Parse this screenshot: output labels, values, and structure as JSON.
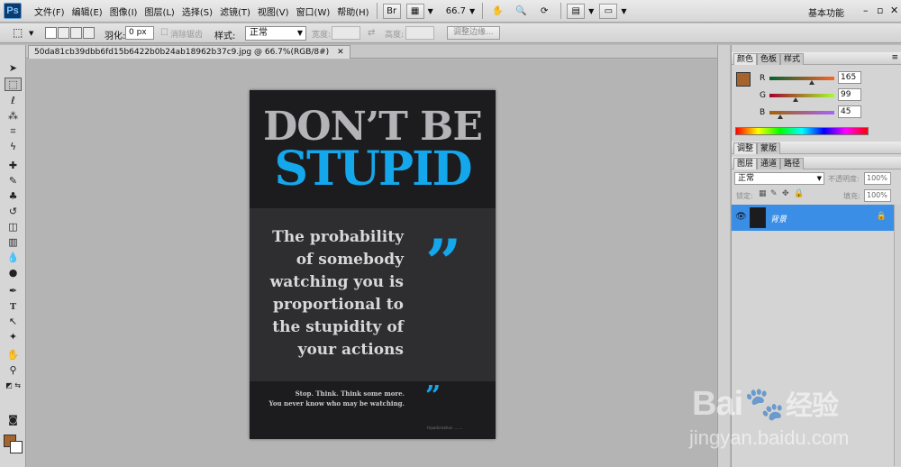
{
  "app": {
    "logo": "Ps"
  },
  "menu": [
    "文件(F)",
    "编辑(E)",
    "图像(I)",
    "图层(L)",
    "选择(S)",
    "滤镜(T)",
    "视图(V)",
    "窗口(W)",
    "帮助(H)"
  ],
  "toolbar": {
    "zoom": "66.7",
    "workspace": "基本功能"
  },
  "options": {
    "feather_label": "羽化:",
    "feather_value": "0 px",
    "antialias_label": "消除锯齿",
    "style_label": "样式:",
    "style_value": "正常",
    "width_label": "宽度:",
    "height_label": "高度:",
    "refine_edge": "调整边缘..."
  },
  "document": {
    "tab_title": "50da81cb39dbb6fd15b6422b0b24ab18962b37c9.jpg @ 66.7%(RGB/8#)",
    "close": "✕"
  },
  "poster": {
    "headline_line1": "DON’T BE",
    "headline_line2": "STUPID",
    "quote_lines": [
      "The probability",
      "of somebody",
      "watching you is",
      "proportional to",
      "the stupidity of",
      "your actions"
    ],
    "quote_mark": "”",
    "footer_line1": "Stop. Think. Think some more.",
    "footer_line2": "You never know who may be watching.",
    "credit": "tripadcreative ........",
    "accent_color": "#14a7ec"
  },
  "color_panel": {
    "tabs": [
      "颜色",
      "色板",
      "样式"
    ],
    "r_label": "R",
    "r_value": "165",
    "g_label": "G",
    "g_value": "99",
    "b_label": "B",
    "b_value": "45",
    "foreground_color": "#a5632d"
  },
  "adjust_panel": {
    "tabs": [
      "调整",
      "蒙版"
    ]
  },
  "layers_panel": {
    "tabs": [
      "图层",
      "通道",
      "路径"
    ],
    "blend_mode": "正常",
    "opacity_label": "不透明度:",
    "opacity_value": "100%",
    "lock_label": "锁定:",
    "fill_label": "填充:",
    "fill_value": "100%",
    "layer_name": "背景"
  },
  "watermark": {
    "brand": "Bai",
    "brand2": "经验",
    "url": "jingyan.baidu.com"
  }
}
